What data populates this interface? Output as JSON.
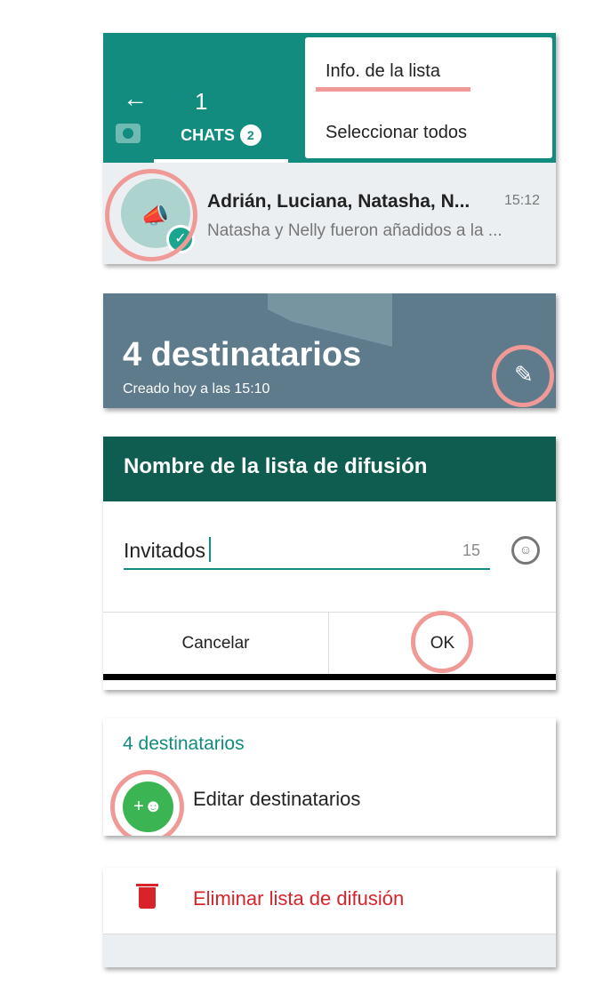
{
  "toolbar": {
    "selected_count": "1",
    "tab_label": "CHATS",
    "tab_badge": "2"
  },
  "menu": {
    "items": [
      "Info. de la lista",
      "Seleccionar todos"
    ]
  },
  "chat_row": {
    "name": "Adrián, Luciana, Natasha, N...",
    "time": "15:12",
    "preview": "Natasha y Nelly fueron añadidos a la ..."
  },
  "list_header": {
    "title": "4 destinatarios",
    "subtitle": "Creado hoy a las 15:10"
  },
  "dialog": {
    "title": "Nombre de la lista de difusión",
    "input_value": "Invitados",
    "char_count": "15",
    "cancel": "Cancelar",
    "ok": "OK"
  },
  "recipients": {
    "title": "4 destinatarios",
    "edit_label": "Editar destinatarios"
  },
  "delete": {
    "label": "Eliminar lista de difusión"
  },
  "colors": {
    "teal": "#128c7e",
    "dark_teal": "#0f5d51",
    "highlight": "#f09a97",
    "danger": "#d8232a",
    "green": "#3bb454"
  }
}
